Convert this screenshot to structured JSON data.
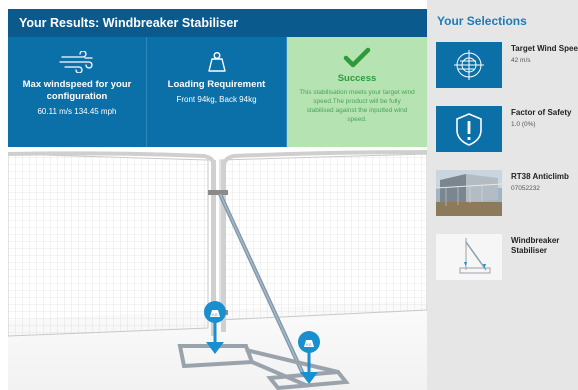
{
  "results": {
    "header": "Your Results: Windbreaker Stabiliser",
    "cards": [
      {
        "title": "Max windspeed for your configuration",
        "value": "60.11 m/s 134.45 mph",
        "icon": "wind-icon"
      },
      {
        "title": "Loading Requirement",
        "value": "Front 94kg, Back 94kg",
        "icon": "weight-icon"
      },
      {
        "title": "Success",
        "value": "This stabilisation meets your target wind speed.The product will be fully stabilised against the inputted wind speed.",
        "icon": "checkmark-icon"
      }
    ]
  },
  "scene": {
    "weight_labels": [
      "KG",
      "KG"
    ]
  },
  "selections": {
    "title": "Your Selections",
    "items": [
      {
        "name": "Target Wind Speed",
        "value": "42 m/s",
        "icon": "wind-target-icon"
      },
      {
        "name": "Factor of Safety",
        "value": "1.0 (0%)",
        "icon": "shield-alert-icon"
      },
      {
        "name": "RT38 Anticlimb",
        "value": "07052232",
        "icon": "fence-photo"
      },
      {
        "name": "Windbreaker Stabiliser",
        "value": "",
        "icon": "stabiliser-diagram"
      }
    ]
  },
  "colors": {
    "header_bg": "#0a5a8e",
    "card_bg": "#0b6fa8",
    "success_bg": "#b6e3b2",
    "success_text": "#2f9a3c",
    "accent": "#1b7db8",
    "weight_marker": "#1a8fd0"
  }
}
